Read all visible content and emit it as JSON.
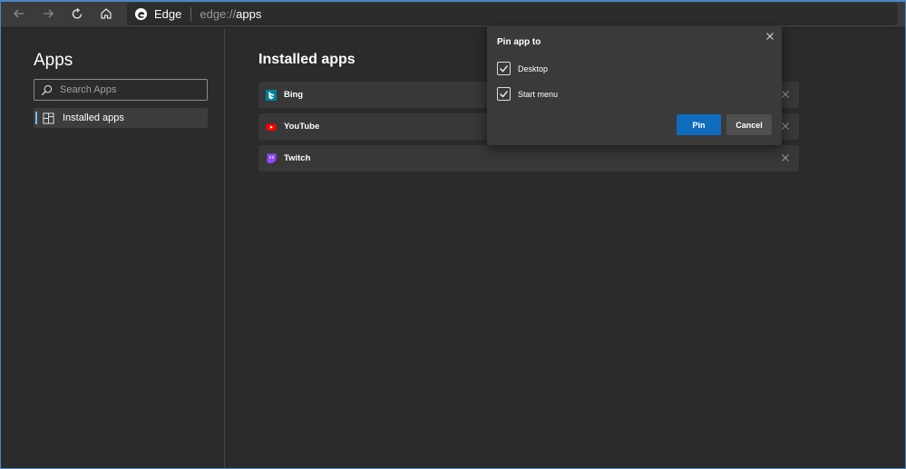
{
  "toolbar": {
    "icons": [
      "back-icon",
      "forward-icon",
      "refresh-icon",
      "home-icon"
    ],
    "site_name": "Edge",
    "url_scheme": "edge://",
    "url_path": "apps"
  },
  "sidebar": {
    "title": "Apps",
    "search_placeholder": "Search Apps",
    "nav": [
      {
        "label": "Installed apps",
        "icon": "apps-grid-icon",
        "selected": true
      }
    ]
  },
  "main": {
    "title": "Installed apps",
    "apps": [
      {
        "name": "Bing",
        "icon": "bing-icon",
        "color": "#00809d"
      },
      {
        "name": "YouTube",
        "icon": "youtube-icon",
        "color": "#ff0000"
      },
      {
        "name": "Twitch",
        "icon": "twitch-icon",
        "color": "#9146ff"
      }
    ]
  },
  "dialog": {
    "title": "Pin app to",
    "options": [
      {
        "label": "Desktop",
        "checked": true
      },
      {
        "label": "Start menu",
        "checked": true
      }
    ],
    "primary_label": "Pin",
    "secondary_label": "Cancel"
  },
  "colors": {
    "accent": "#0f6cbd",
    "background": "#2b2b2b",
    "toolbar": "#3b3b3b",
    "frame": "#4a86c5"
  }
}
